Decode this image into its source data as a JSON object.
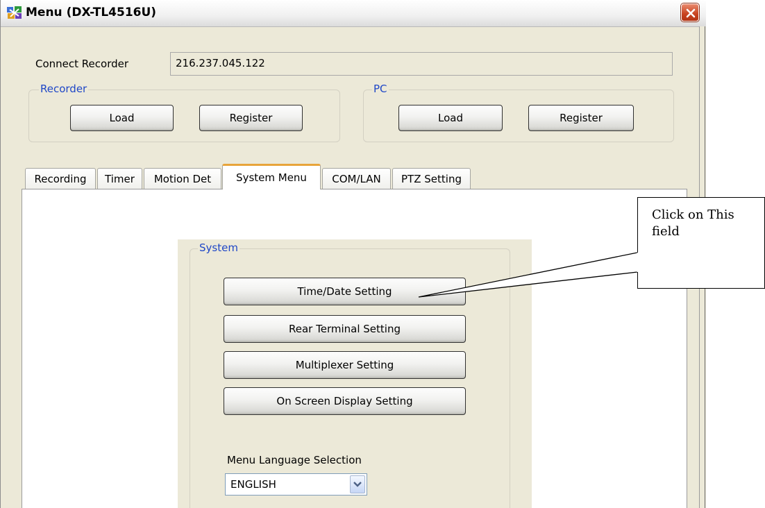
{
  "window": {
    "title": "Menu (DX-TL4516U)",
    "icon": "app-icon",
    "close_icon": "close-x-icon"
  },
  "connect": {
    "label": "Connect Recorder",
    "value": "216.237.045.122"
  },
  "recorder_group": {
    "title": "Recorder",
    "load_label": "Load",
    "register_label": "Register"
  },
  "pc_group": {
    "title": "PC",
    "load_label": "Load",
    "register_label": "Register"
  },
  "tabs": [
    {
      "label": "Recording",
      "active": false
    },
    {
      "label": "Timer",
      "active": false
    },
    {
      "label": "Motion Det",
      "active": false
    },
    {
      "label": "System Menu",
      "active": true
    },
    {
      "label": "COM/LAN",
      "active": false
    },
    {
      "label": "PTZ Setting",
      "active": false
    }
  ],
  "system": {
    "title": "System",
    "buttons": [
      "Time/Date Setting",
      "Rear Terminal Setting",
      "Multiplexer Setting",
      "On Screen Display Setting"
    ],
    "language_label": "Menu Language Selection",
    "language_value": "ENGLISH"
  },
  "callout": {
    "text": "Click on This field"
  },
  "colors": {
    "window_bg": "#ece9d8",
    "group_title": "#1f47c7",
    "active_tab_accent": "#e8a43a",
    "close_button": "#c8431f"
  }
}
